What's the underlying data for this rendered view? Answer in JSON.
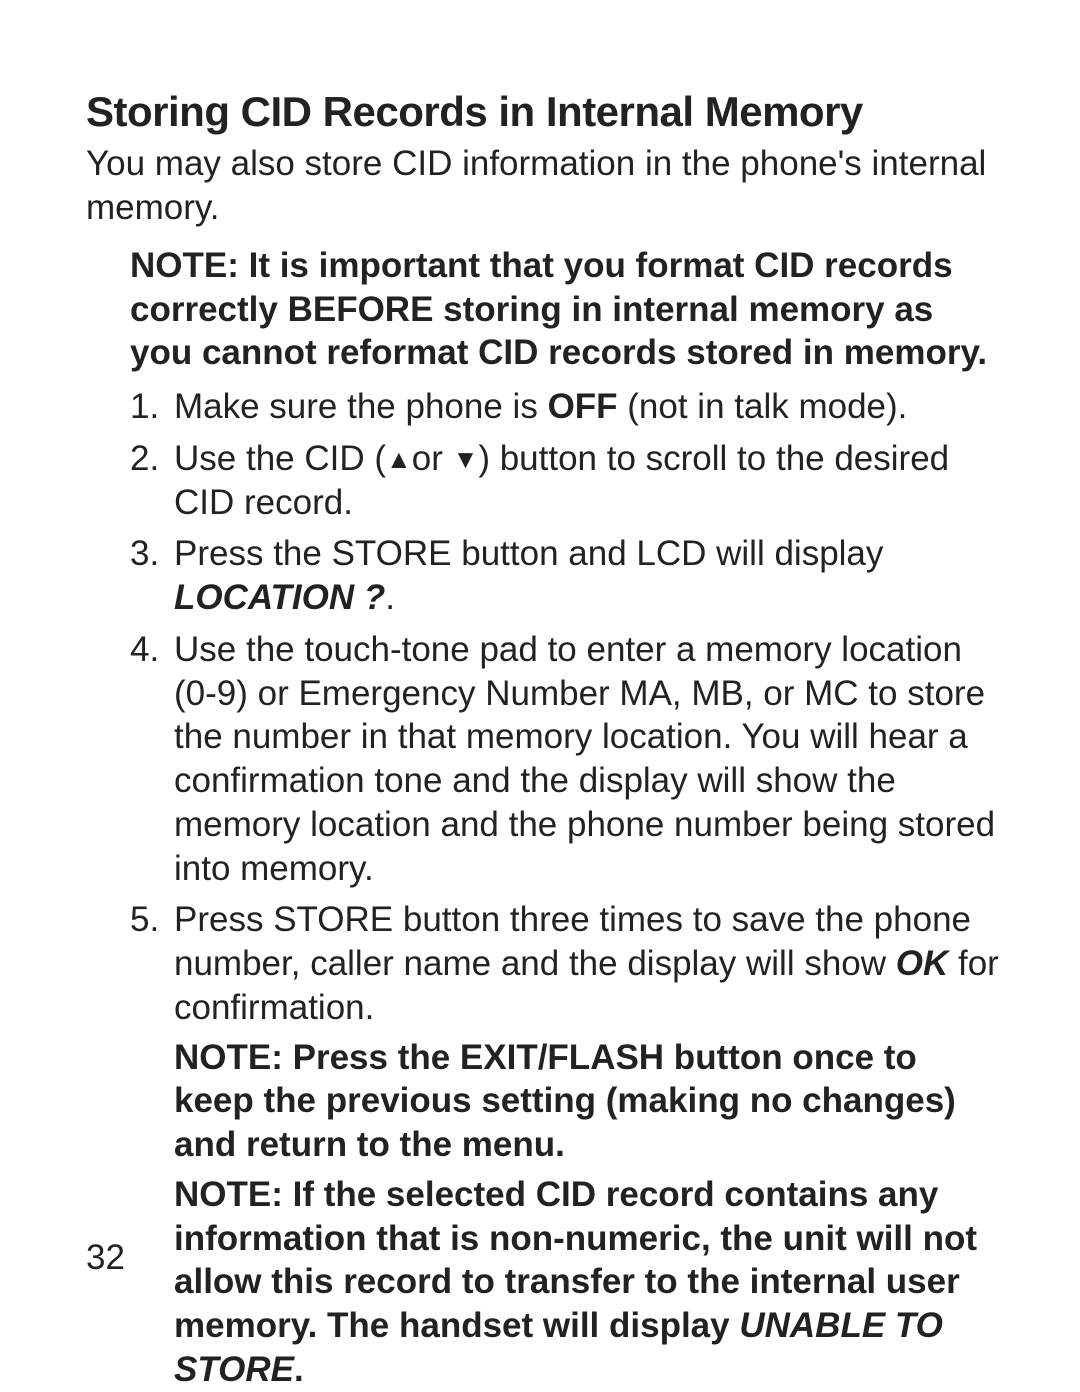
{
  "title": "Storing CID Records in Internal Memory",
  "intro": "You may also store CID information in the phone's internal memory.",
  "note_top": "NOTE: It is important that you format CID records correctly BEFORE storing in internal memory as you cannot reformat CID records stored in memory.",
  "step1": {
    "a": "Make sure the phone is ",
    "off": "OFF",
    "b": " (not in talk mode)."
  },
  "step2": {
    "a": "Use the CID (",
    "up": "▲",
    "mid": "or ",
    "down": "▼",
    "b": ")  button to scroll to the desired CID record."
  },
  "step3": {
    "a": "Press the STORE button and LCD will display ",
    "loc": "LOCATION ?",
    "b": "."
  },
  "step4": "Use the touch-tone pad to enter a memory location (0-9) or Emergency Number MA, MB, or MC to store the number in that memory location. You will hear a confirmation tone and the display will show the memory location and the phone number being stored into memory.",
  "step5": {
    "a": "Press STORE button three times to save the phone number, caller name and the display will show ",
    "ok": "OK",
    "b": " for confirmation."
  },
  "note_exit": "NOTE: Press the EXIT/FLASH button once to keep the previous setting (making no changes) and return to the menu.",
  "note_unable": {
    "a": "NOTE: If the selected CID record contains any information that is non-numeric, the unit will not allow this record to transfer to the internal user memory. The handset will display ",
    "u": "UNABLE TO STORE",
    "b": "."
  },
  "page_number": "32"
}
